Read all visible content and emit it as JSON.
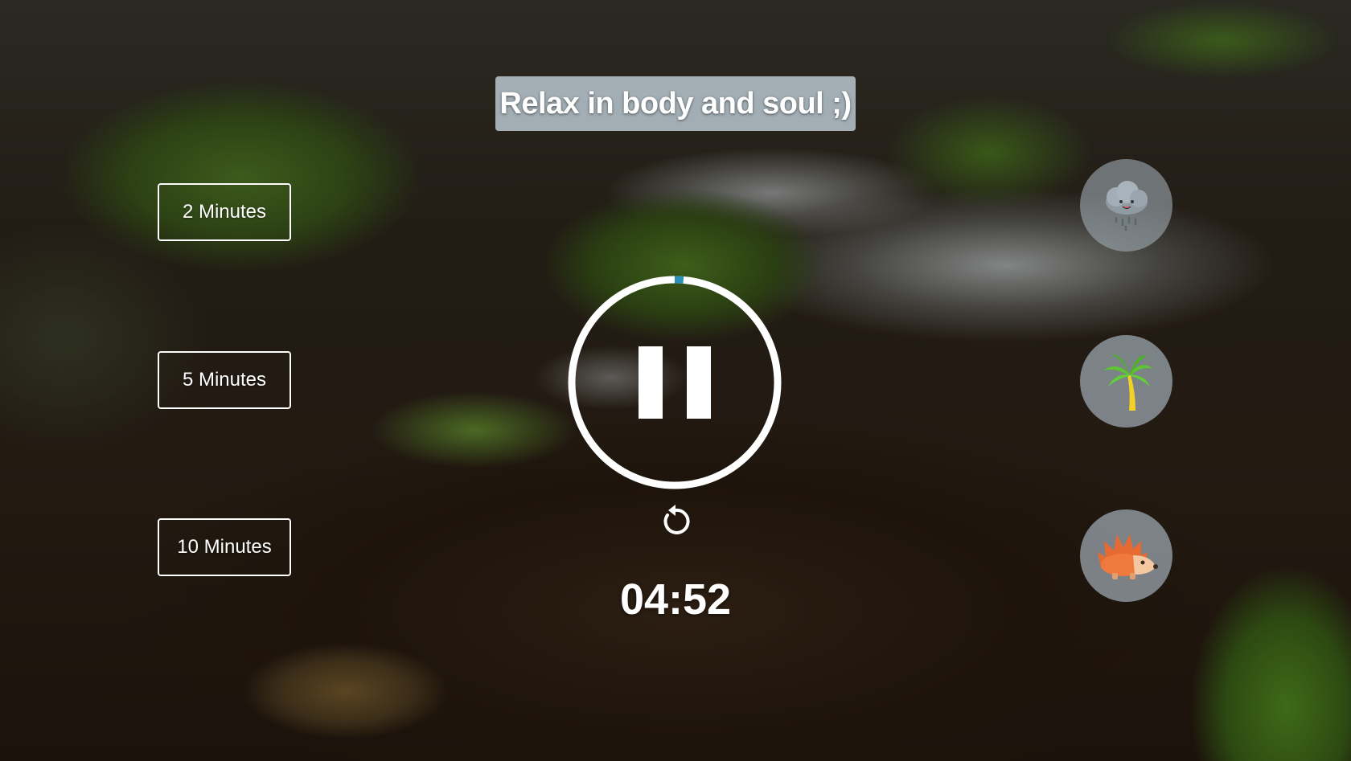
{
  "header": {
    "title": "Relax in body and soul ;)"
  },
  "durations": [
    {
      "label": "2 Minutes"
    },
    {
      "label": "5 Minutes"
    },
    {
      "label": "10 Minutes"
    }
  ],
  "player": {
    "state": "playing",
    "control_icon": "pause-icon",
    "progress_fraction": 0.027,
    "ring_color": "#ffffff",
    "progress_color": "#2e8fb8",
    "timer": "04:52",
    "reset_icon": "replay-icon"
  },
  "sounds": [
    {
      "name": "rain-cloud-icon"
    },
    {
      "name": "palm-tree-icon"
    },
    {
      "name": "hedgehog-icon"
    }
  ]
}
